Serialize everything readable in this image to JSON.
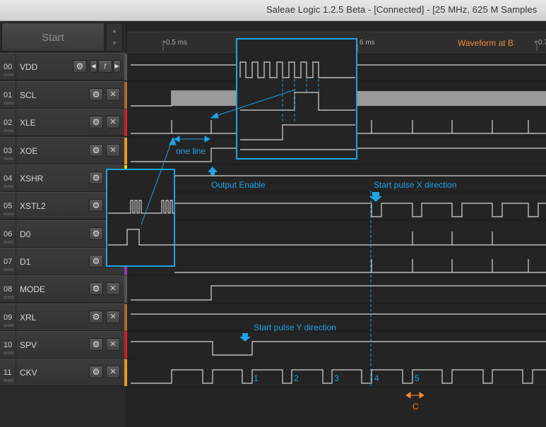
{
  "window": {
    "title": "Saleae Logic 1.2.5 Beta - [Connected] - [25 MHz, 625 M Samples"
  },
  "capture": {
    "start_label": "Start"
  },
  "ruler": {
    "ticks": [
      "+0.5 ms",
      "6 ms",
      "+0.7"
    ]
  },
  "channels": [
    {
      "num": "00",
      "name": "VDD",
      "color": "#555555"
    },
    {
      "num": "01",
      "name": "SCL",
      "color": "#b0662a"
    },
    {
      "num": "02",
      "name": "XLE",
      "color": "#d22020"
    },
    {
      "num": "03",
      "name": "XOE",
      "color": "#e89a1a"
    },
    {
      "num": "04",
      "name": "XSHR",
      "color": "#e8d21a"
    },
    {
      "num": "05",
      "name": "XSTL2",
      "color": "#4a8a2a"
    },
    {
      "num": "06",
      "name": "D0",
      "color": "#2a6ab0"
    },
    {
      "num": "07",
      "name": "D1",
      "color": "#8a3ab0"
    },
    {
      "num": "08",
      "name": "MODE",
      "color": "#555555"
    },
    {
      "num": "09",
      "name": "XRL",
      "color": "#b0662a"
    },
    {
      "num": "10",
      "name": "SPV",
      "color": "#d22020"
    },
    {
      "num": "11",
      "name": "CKV",
      "color": "#e89a1a"
    }
  ],
  "annotations": {
    "waveform_at_b": "Waveform at  B",
    "one_line": "one line",
    "output_enable": "Output Enable",
    "start_pulse_x": "Start pulse X direction",
    "start_pulse_y": "Start pulse Y direction",
    "clock_numbers": [
      "1",
      "2",
      "3",
      "4",
      "5"
    ],
    "c_label": "C"
  },
  "colors": {
    "annotation_blue": "#1fa3e6",
    "annotation_orange": "#f08a30",
    "signal": "#d8d8d8"
  }
}
